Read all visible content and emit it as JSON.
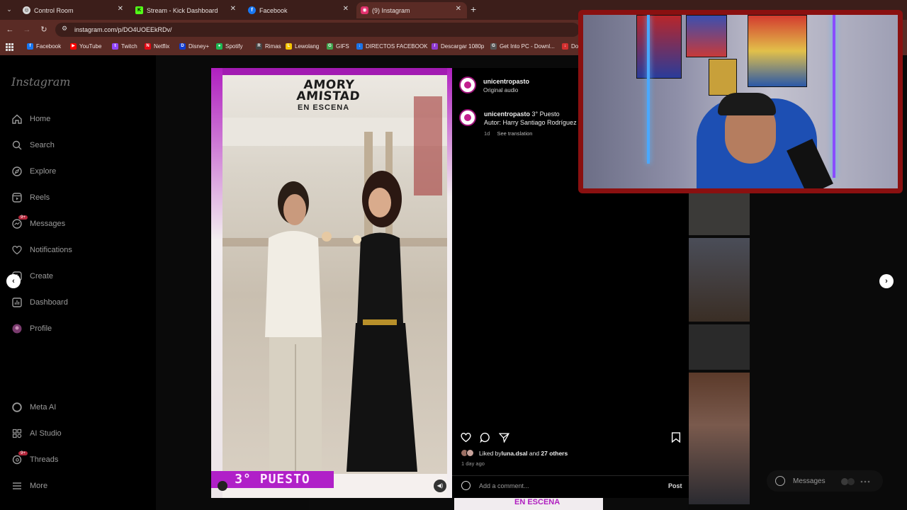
{
  "browser": {
    "tabs": [
      {
        "title": "Control Room",
        "icon": "globe-icon",
        "color": "#d9d9d9"
      },
      {
        "title": "Stream - Kick Dashboard",
        "icon": "kick-icon",
        "color": "#53fc18"
      },
      {
        "title": "Facebook",
        "icon": "facebook-icon",
        "color": "#1877f2"
      },
      {
        "title": "(9) Instagram",
        "icon": "instagram-icon",
        "color": "#e1306c"
      }
    ],
    "url": "instagram.com/p/DO4UOEEkRDv/",
    "bookmarks": [
      {
        "label": "Facebook",
        "color": "#1877f2",
        "glyph": "f"
      },
      {
        "label": "YouTube",
        "color": "#ff0000",
        "glyph": "▶"
      },
      {
        "label": "Twitch",
        "color": "#9146ff",
        "glyph": "t"
      },
      {
        "label": "Netflix",
        "color": "#e50914",
        "glyph": "N"
      },
      {
        "label": "Disney+",
        "color": "#113ccf",
        "glyph": "D"
      },
      {
        "label": "Spotify",
        "color": "#1db954",
        "glyph": "●"
      },
      {
        "label": "Rimas",
        "color": "#444444",
        "glyph": "R"
      },
      {
        "label": "Lewolang",
        "color": "#f5c400",
        "glyph": "L"
      },
      {
        "label": "GIFS",
        "color": "#3fa34d",
        "glyph": "G"
      },
      {
        "label": "DIRECTOS FACEBOOK",
        "color": "#1a73e8",
        "glyph": "↓"
      },
      {
        "label": "Descargar 1080p",
        "color": "#8e3ad1",
        "glyph": "/"
      },
      {
        "label": "Get Into PC - Downl...",
        "color": "#555555",
        "glyph": "G"
      },
      {
        "label": "Do",
        "color": "#d32f2f",
        "glyph": "↓"
      }
    ]
  },
  "instagram": {
    "logo": "Instagram",
    "sidebar": [
      {
        "label": "Home",
        "icon": "home-icon"
      },
      {
        "label": "Search",
        "icon": "search-icon"
      },
      {
        "label": "Explore",
        "icon": "compass-icon"
      },
      {
        "label": "Reels",
        "icon": "reels-icon"
      },
      {
        "label": "Messages",
        "icon": "messenger-icon",
        "badge": "9+"
      },
      {
        "label": "Notifications",
        "icon": "heart-icon"
      },
      {
        "label": "Create",
        "icon": "plus-square-icon"
      },
      {
        "label": "Dashboard",
        "icon": "chart-icon"
      },
      {
        "label": "Profile",
        "icon": "avatar-icon"
      }
    ],
    "sidebar_bottom": [
      {
        "label": "Meta AI",
        "icon": "meta-ai-icon"
      },
      {
        "label": "AI Studio",
        "icon": "ai-studio-icon"
      },
      {
        "label": "Threads",
        "icon": "threads-icon",
        "badge": "9+"
      },
      {
        "label": "More",
        "icon": "menu-icon"
      }
    ],
    "post": {
      "media_title_1": "AMORY",
      "media_title_2": "AMISTAD",
      "media_title_3": "EN ESCENA",
      "media_place": "3° PUESTO",
      "author": "unicentropasto",
      "audio": "Original audio",
      "caption_user": "unicentropasto",
      "caption_text": "3° Puesto",
      "caption_line2": "Autor: Harry Santiago Rodríguez",
      "caption_age": "1d",
      "see_translation": "See translation",
      "liked_prefix": "Liked by ",
      "liked_user": "luna.dsal",
      "liked_mid": " and ",
      "liked_others": "27 others",
      "time": "1 day ago",
      "comment_placeholder": "Add a comment...",
      "post_button": "Post"
    },
    "messages_pill": "Messages",
    "bottom_band_text": "EN ESCENA"
  }
}
